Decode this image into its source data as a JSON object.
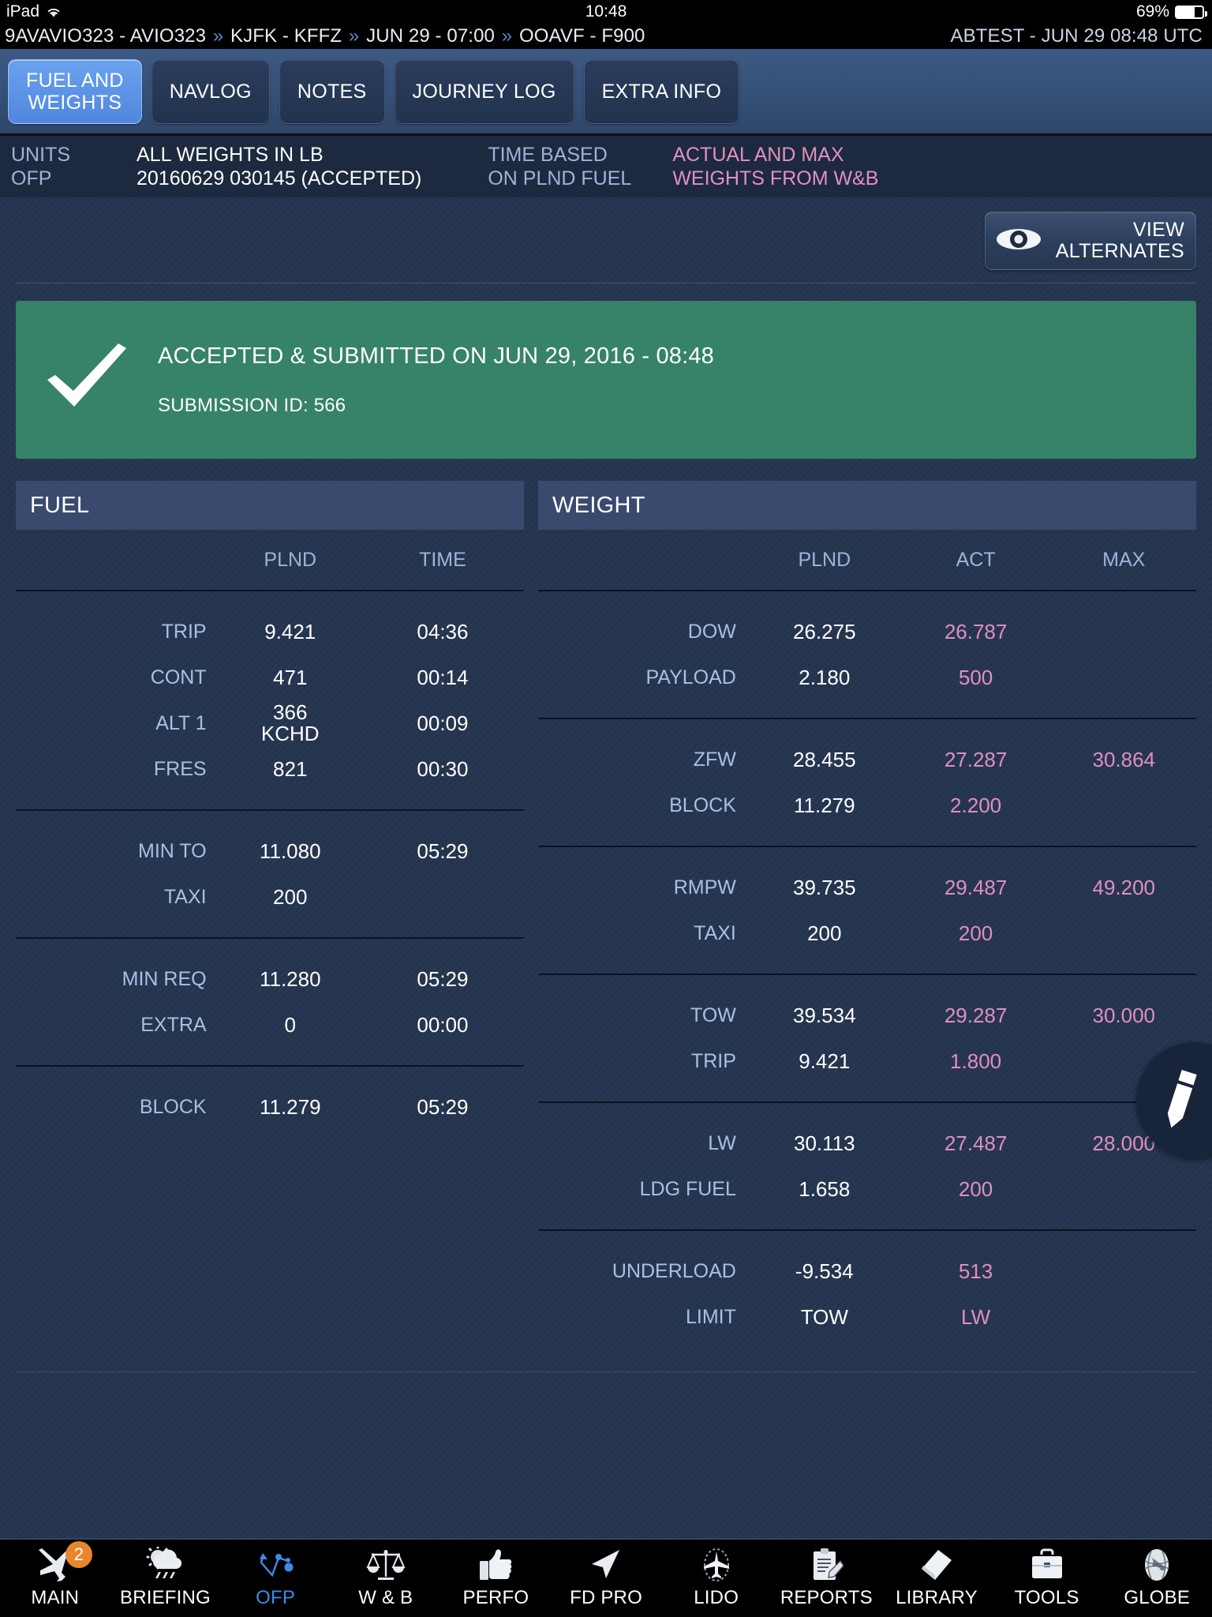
{
  "status_bar": {
    "device": "iPad",
    "wifi_icon": "wifi-icon",
    "time": "10:48",
    "battery_percent": "69%",
    "battery_level": 69
  },
  "flight_bar": {
    "segments": [
      "9AVAVIO323 - AVIO323",
      "KJFK - KFFZ",
      "JUN 29 - 07:00",
      "OOAVF - F900"
    ],
    "separator": "»",
    "right": "ABTEST - JUN 29 08:48 UTC"
  },
  "tabs": [
    {
      "label": "FUEL AND\nWEIGHTS",
      "line1": "FUEL AND",
      "line2": "WEIGHTS",
      "active": true
    },
    {
      "label": "NAVLOG",
      "active": false
    },
    {
      "label": "NOTES",
      "active": false
    },
    {
      "label": "JOURNEY LOG",
      "active": false
    },
    {
      "label": "EXTRA INFO",
      "active": false
    }
  ],
  "info_strip": {
    "units_label": "UNITS",
    "ofp_label": "OFP",
    "units_value": "ALL WEIGHTS IN LB",
    "ofp_value": "20160629 030145 (ACCEPTED)",
    "time_based_line1": "TIME BASED",
    "time_based_line2": "ON PLND FUEL",
    "wb_line1": "ACTUAL AND MAX",
    "wb_line2": "WEIGHTS FROM W&B"
  },
  "view_alternates": {
    "icon": "eye-icon",
    "line1": "VIEW",
    "line2": "ALTERNATES"
  },
  "banner": {
    "icon": "checkmark-icon",
    "title": "ACCEPTED & SUBMITTED ON JUN 29, 2016 - 08:48",
    "submission": "SUBMISSION ID: 566",
    "color": "#36836a"
  },
  "fuel_panel": {
    "title": "FUEL",
    "columns": [
      "",
      "PLND",
      "TIME"
    ],
    "groups": [
      [
        {
          "label": "TRIP",
          "plnd": "9.421",
          "sub": "",
          "time": "04:36"
        },
        {
          "label": "CONT",
          "plnd": "471",
          "sub": "",
          "time": "00:14"
        },
        {
          "label": "ALT 1",
          "plnd": "366",
          "sub": "KCHD",
          "time": "00:09"
        },
        {
          "label": "FRES",
          "plnd": "821",
          "sub": "",
          "time": "00:30"
        }
      ],
      [
        {
          "label": "MIN TO",
          "plnd": "11.080",
          "sub": "",
          "time": "05:29"
        },
        {
          "label": "TAXI",
          "plnd": "200",
          "sub": "",
          "time": ""
        }
      ],
      [
        {
          "label": "MIN REQ",
          "plnd": "11.280",
          "sub": "",
          "time": "05:29"
        },
        {
          "label": "EXTRA",
          "plnd": "0",
          "sub": "",
          "time": "00:00"
        }
      ],
      [
        {
          "label": "BLOCK",
          "plnd": "11.279",
          "sub": "",
          "time": "05:29"
        }
      ]
    ]
  },
  "weight_panel": {
    "title": "WEIGHT",
    "columns": [
      "",
      "PLND",
      "ACT",
      "MAX"
    ],
    "groups": [
      [
        {
          "label": "DOW",
          "plnd": "26.275",
          "act": "26.787",
          "max": ""
        },
        {
          "label": "PAYLOAD",
          "plnd": "2.180",
          "act": "500",
          "max": ""
        }
      ],
      [
        {
          "label": "ZFW",
          "plnd": "28.455",
          "act": "27.287",
          "max": "30.864"
        },
        {
          "label": "BLOCK",
          "plnd": "11.279",
          "act": "2.200",
          "max": ""
        }
      ],
      [
        {
          "label": "RMPW",
          "plnd": "39.735",
          "act": "29.487",
          "max": "49.200"
        },
        {
          "label": "TAXI",
          "plnd": "200",
          "act": "200",
          "max": ""
        }
      ],
      [
        {
          "label": "TOW",
          "plnd": "39.534",
          "act": "29.287",
          "max": "30.000"
        },
        {
          "label": "TRIP",
          "plnd": "9.421",
          "act": "1.800",
          "max": ""
        }
      ],
      [
        {
          "label": "LW",
          "plnd": "30.113",
          "act": "27.487",
          "max": "28.000"
        },
        {
          "label": "LDG FUEL",
          "plnd": "1.658",
          "act": "200",
          "max": ""
        }
      ],
      [
        {
          "label": "UNDERLOAD",
          "plnd": "-9.534",
          "act": "513",
          "max": ""
        },
        {
          "label": "LIMIT",
          "plnd": "TOW",
          "act": "LW",
          "max": ""
        }
      ]
    ]
  },
  "edit_fab": {
    "icon": "pencil-icon"
  },
  "toolbar": {
    "items": [
      {
        "label": "MAIN",
        "icon": "airplane-icon",
        "badge": "2",
        "active": false
      },
      {
        "label": "BRIEFING",
        "icon": "weather-icon",
        "badge": "",
        "active": false
      },
      {
        "label": "OFP",
        "icon": "route-icon",
        "badge": "",
        "active": true
      },
      {
        "label": "W & B",
        "icon": "scales-icon",
        "badge": "",
        "active": false
      },
      {
        "label": "PERFO",
        "icon": "thumbsup-icon",
        "badge": "",
        "active": false
      },
      {
        "label": "FD PRO",
        "icon": "cursor-icon",
        "badge": "",
        "active": false
      },
      {
        "label": "LIDO",
        "icon": "lido-plane-icon",
        "badge": "",
        "active": false
      },
      {
        "label": "REPORTS",
        "icon": "clipboard-icon",
        "badge": "",
        "active": false
      },
      {
        "label": "LIBRARY",
        "icon": "book-icon",
        "badge": "",
        "active": false
      },
      {
        "label": "TOOLS",
        "icon": "briefcase-icon",
        "badge": "",
        "active": false
      },
      {
        "label": "GLOBE",
        "icon": "globe-icon",
        "badge": "",
        "active": false
      }
    ]
  },
  "colors": {
    "background": "#25344e",
    "panel_header": "#3a4a6e",
    "accent_blue": "#4f87dd",
    "label_blue": "#a8c0e4",
    "pink": "#df8fc1",
    "green": "#36836a",
    "badge_orange": "#e8862c"
  }
}
